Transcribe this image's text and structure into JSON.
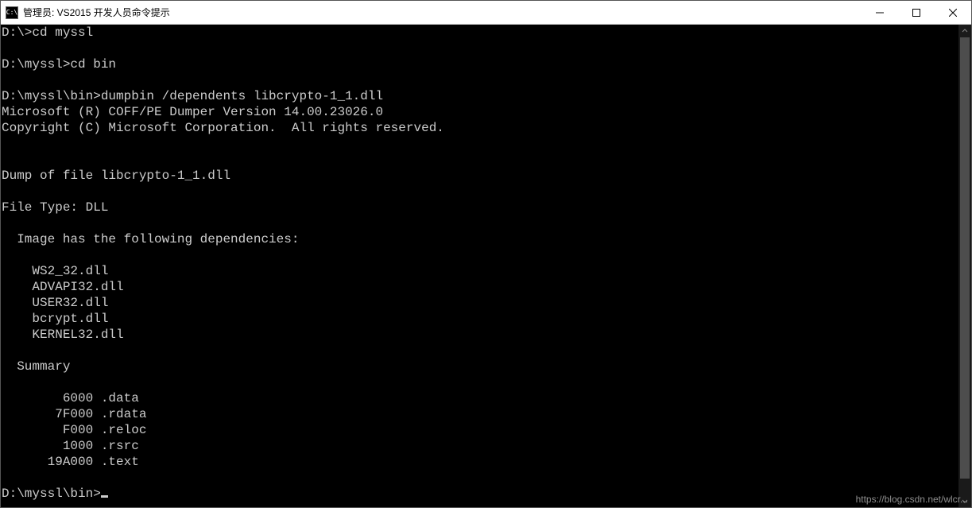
{
  "window": {
    "title": "管理员: VS2015 开发人员命令提示",
    "icon_label": "C:\\"
  },
  "terminal": {
    "lines": [
      "D:\\>cd myssl",
      "",
      "D:\\myssl>cd bin",
      "",
      "D:\\myssl\\bin>dumpbin /dependents libcrypto-1_1.dll",
      "Microsoft (R) COFF/PE Dumper Version 14.00.23026.0",
      "Copyright (C) Microsoft Corporation.  All rights reserved.",
      "",
      "",
      "Dump of file libcrypto-1_1.dll",
      "",
      "File Type: DLL",
      "",
      "  Image has the following dependencies:",
      "",
      "    WS2_32.dll",
      "    ADVAPI32.dll",
      "    USER32.dll",
      "    bcrypt.dll",
      "    KERNEL32.dll",
      "",
      "  Summary",
      "",
      "        6000 .data",
      "       7F000 .rdata",
      "        F000 .reloc",
      "        1000 .rsrc",
      "      19A000 .text",
      ""
    ],
    "final_prompt": "D:\\myssl\\bin>"
  },
  "watermark": "https://blog.csdn.net/wlcr..."
}
